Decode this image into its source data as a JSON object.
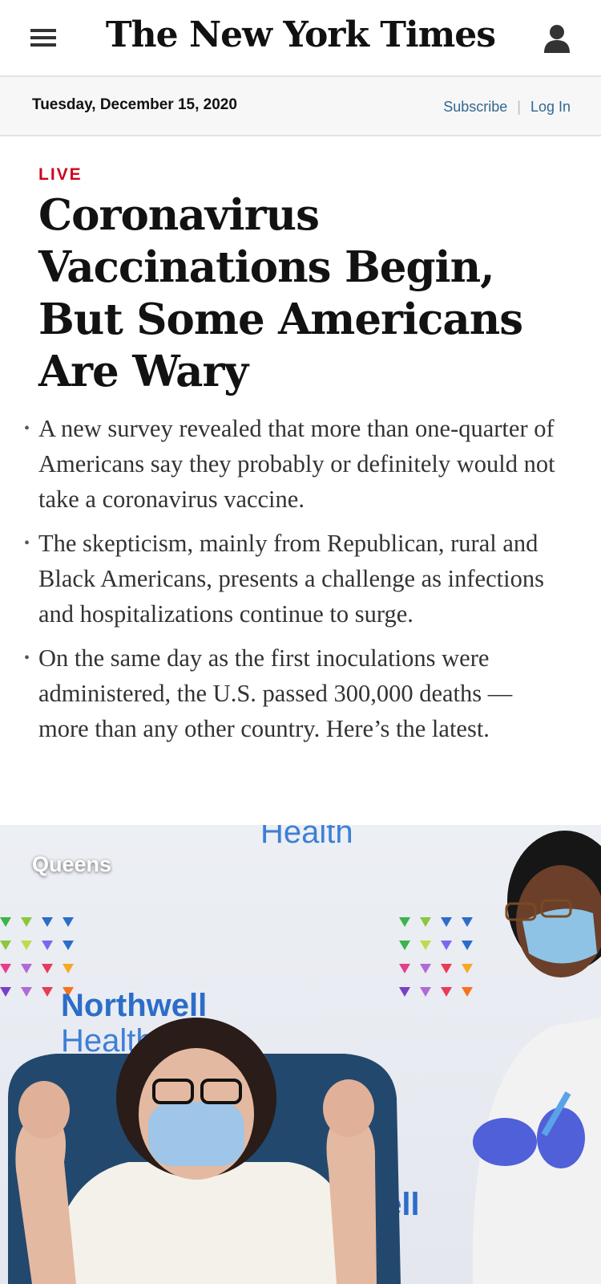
{
  "masthead": {
    "logo_text": "The New York Times",
    "menu_icon": "hamburger-menu-icon",
    "account_icon": "person-icon"
  },
  "datebar": {
    "date": "Tuesday, December 15, 2020",
    "subscribe": "Subscribe",
    "login": "Log In"
  },
  "article": {
    "kicker": "LIVE",
    "headline": "Coronavirus Vaccinations Begin, But Some Americans Are Wary",
    "bullets": [
      "A new survey revealed that more than one-quarter of Americans say they probably or definitely would not take a coronavirus vaccine.",
      "The skepticism, mainly from Republican, rural and Black Americans, presents a challenge as infections and hospitalizations continue to surge.",
      "On the same day as the first inoculations were administered, the U.S. passed 300,000 deaths — more than any other country. Here’s the latest."
    ]
  },
  "photo": {
    "label": "Queens",
    "backdrop_brand_top": "Health",
    "backdrop_brand_name": "Northwell",
    "backdrop_brand_sub": "Health",
    "backdrop_brand_partial": "well"
  },
  "colors": {
    "live_red": "#d0021b",
    "link_blue": "#326891",
    "brand_blue": "#2c6dc9"
  }
}
